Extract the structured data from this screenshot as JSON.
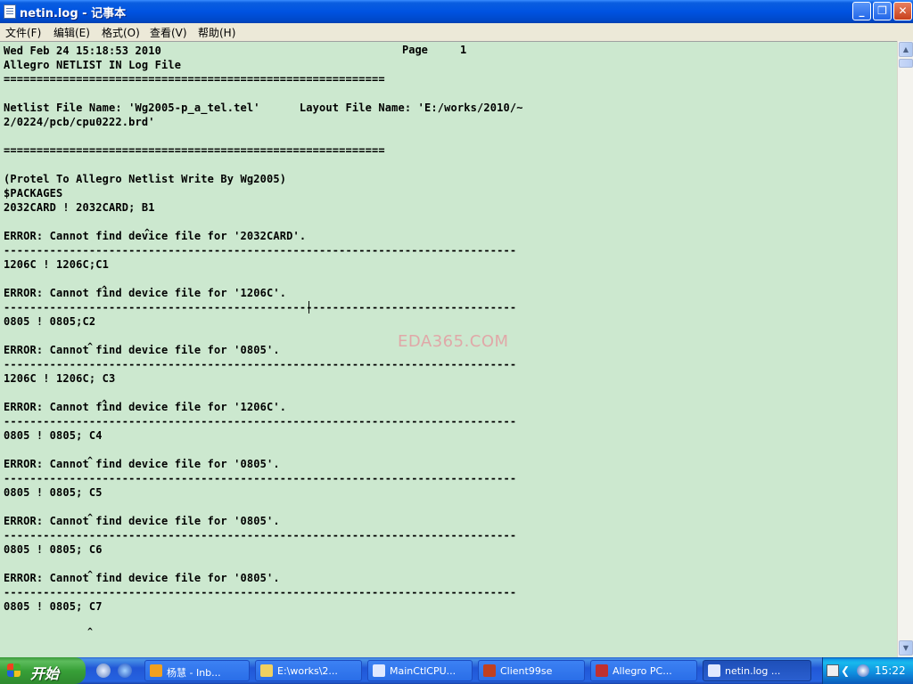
{
  "window": {
    "title": "netin.log - 记事本",
    "buttons": {
      "minimize": "_",
      "maximize": "❐",
      "close": "✕"
    }
  },
  "menu": [
    {
      "label": "文件(F)"
    },
    {
      "label": "编辑(E)"
    },
    {
      "label": "格式(O)"
    },
    {
      "label": "查看(V)"
    },
    {
      "label": "帮助(H)"
    }
  ],
  "editor": {
    "header_date": "Wed Feb 24 15:18:53 2010",
    "page_label": "Page     1",
    "lines": [
      {
        "text": "",
        "y": 0
      },
      {
        "text": "Allegro NETLIST IN Log File"
      },
      {
        "text": "=========================================================="
      },
      {
        "text": ""
      },
      {
        "text": "Netlist File Name: 'Wg2005-p_a_tel.tel'      Layout File Name: 'E:/works/2010/~"
      },
      {
        "text": "2/0224/pcb/cpu0222.brd'"
      },
      {
        "text": ""
      },
      {
        "text": "=========================================================="
      },
      {
        "text": ""
      },
      {
        "text": "(Protel To Allegro Netlist Write By Wg2005)"
      },
      {
        "text": "$PACKAGES"
      },
      {
        "text": "2032CARD ! 2032CARD; B1"
      },
      {
        "text": ""
      },
      {
        "text": "ERROR: Cannot find device file for '2032CARD'."
      },
      {
        "text": "------------------------------------------------------------------------------"
      },
      {
        "text": "1206C ! 1206C;C1"
      },
      {
        "text": ""
      },
      {
        "text": "ERROR: Cannot find device file for '1206C'."
      },
      {
        "text": "------------------------------------------------------------------------------"
      },
      {
        "text": "0805 ! 0805;C2"
      },
      {
        "text": ""
      },
      {
        "text": "ERROR: Cannot find device file for '0805'."
      },
      {
        "text": "------------------------------------------------------------------------------"
      },
      {
        "text": "1206C ! 1206C; C3"
      },
      {
        "text": ""
      },
      {
        "text": "ERROR: Cannot find device file for '1206C'."
      },
      {
        "text": "------------------------------------------------------------------------------"
      },
      {
        "text": "0805 ! 0805; C4"
      },
      {
        "text": ""
      },
      {
        "text": "ERROR: Cannot find device file for '0805'."
      },
      {
        "text": "------------------------------------------------------------------------------"
      },
      {
        "text": "0805 ! 0805; C5"
      },
      {
        "text": ""
      },
      {
        "text": "ERROR: Cannot find device file for '0805'."
      },
      {
        "text": "------------------------------------------------------------------------------"
      },
      {
        "text": "0805 ! 0805; C6"
      },
      {
        "text": ""
      },
      {
        "text": "ERROR: Cannot find device file for '0805'."
      },
      {
        "text": "------------------------------------------------------------------------------"
      },
      {
        "text": "0805 ! 0805; C7"
      }
    ],
    "watermark": "EDA365.COM",
    "background": "#cce8cf"
  },
  "taskbar": {
    "start_label": "开始",
    "tasks": [
      {
        "label": "杨慧 - Inb...",
        "icon_color": "#f0a020"
      },
      {
        "label": "E:\\works\\2...",
        "icon_color": "#f0d060"
      },
      {
        "label": "MainCtlCPU...",
        "icon_color": "#e0e8ff"
      },
      {
        "label": "Client99se",
        "icon_color": "#c04020"
      },
      {
        "label": "Allegro PC...",
        "icon_color": "#c03030"
      },
      {
        "label": "netin.log ...",
        "icon_color": "#e0e8ff",
        "active": true
      }
    ],
    "clock": "15:22"
  }
}
